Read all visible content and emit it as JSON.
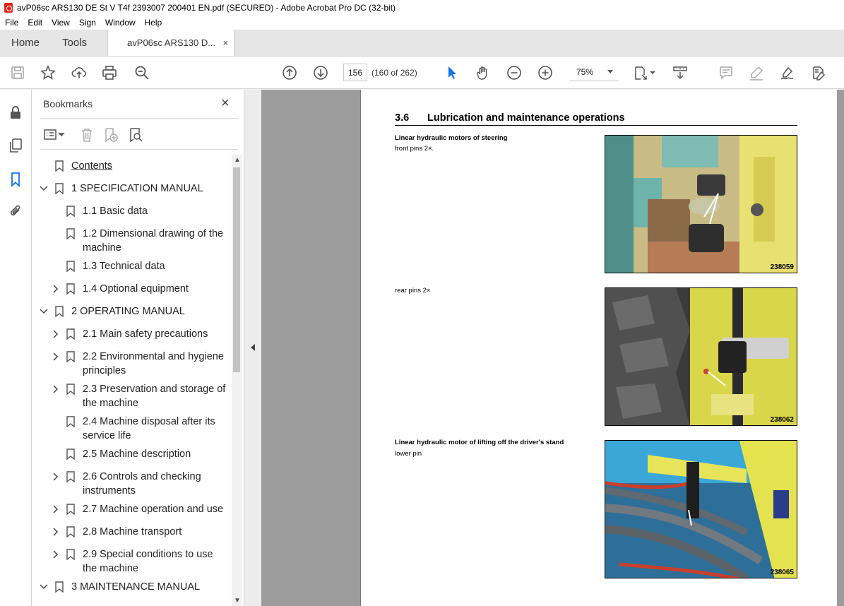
{
  "window": {
    "title": "avP06sc ARS130 DE St V T4f 2393007 200401 EN.pdf (SECURED) - Adobe Acrobat Pro DC (32-bit)"
  },
  "menu": [
    "File",
    "Edit",
    "View",
    "Sign",
    "Window",
    "Help"
  ],
  "tabs": {
    "home": "Home",
    "tools": "Tools",
    "doc": "avP06sc ARS130 D...",
    "close": "×"
  },
  "toolbar": {
    "page_current": "156",
    "page_of": "(160 of 262)",
    "zoom": "75%"
  },
  "bookmarks": {
    "title": "Bookmarks",
    "close": "×",
    "items": [
      {
        "label": "Contents",
        "level": 0,
        "chevron": "",
        "underline": true
      },
      {
        "label": "1 SPECIFICATION MANUAL",
        "level": 0,
        "chevron": "down"
      },
      {
        "label": "1.1 Basic data",
        "level": 1,
        "chevron": ""
      },
      {
        "label": "1.2 Dimensional drawing of the",
        "label2": "machine",
        "level": 1,
        "chevron": ""
      },
      {
        "label": "1.3 Technical data",
        "level": 1,
        "chevron": ""
      },
      {
        "label": "1.4 Optional equipment",
        "level": 1,
        "chevron": "right"
      },
      {
        "label": "2 OPERATING MANUAL",
        "level": 0,
        "chevron": "down"
      },
      {
        "label": "2.1 Main safety precautions",
        "level": 1,
        "chevron": "right"
      },
      {
        "label": "2.2 Environmental and hygiene",
        "label2": "principles",
        "level": 1,
        "chevron": "right"
      },
      {
        "label": "2.3 Preservation and storage of",
        "label2": "the machine",
        "level": 1,
        "chevron": "right"
      },
      {
        "label": "2.4 Machine disposal after its",
        "label2": "service life",
        "level": 1,
        "chevron": ""
      },
      {
        "label": "2.5 Machine description",
        "level": 1,
        "chevron": ""
      },
      {
        "label": "2.6 Controls and checking",
        "label2": "instruments",
        "level": 1,
        "chevron": "right"
      },
      {
        "label": "2.7 Machine operation and use",
        "level": 1,
        "chevron": "right"
      },
      {
        "label": "2.8 Machine transport",
        "level": 1,
        "chevron": "right"
      },
      {
        "label": "2.9 Special conditions to use",
        "label2": "the machine",
        "level": 1,
        "chevron": "right"
      },
      {
        "label": "3 MAINTENANCE MANUAL",
        "level": 0,
        "chevron": "down"
      }
    ]
  },
  "document": {
    "section_number": "3.6",
    "section_title": "Lubrication and maintenance operations",
    "blocks": [
      {
        "heading": "Linear hydraulic motors of steering",
        "text": "front pins 2×.",
        "photo_id": "238059"
      },
      {
        "heading": "",
        "text": "rear pins 2×",
        "photo_id": "238062"
      },
      {
        "heading": "Linear hydraulic motor of lifting off the driver's stand",
        "text": "lower pin",
        "photo_id": "238065"
      }
    ]
  },
  "colors": {
    "accent": "#1473e6",
    "pdf_red": "#e0261c",
    "machine_teal": "#5fa8a0",
    "machine_yellow": "#e8e070"
  }
}
